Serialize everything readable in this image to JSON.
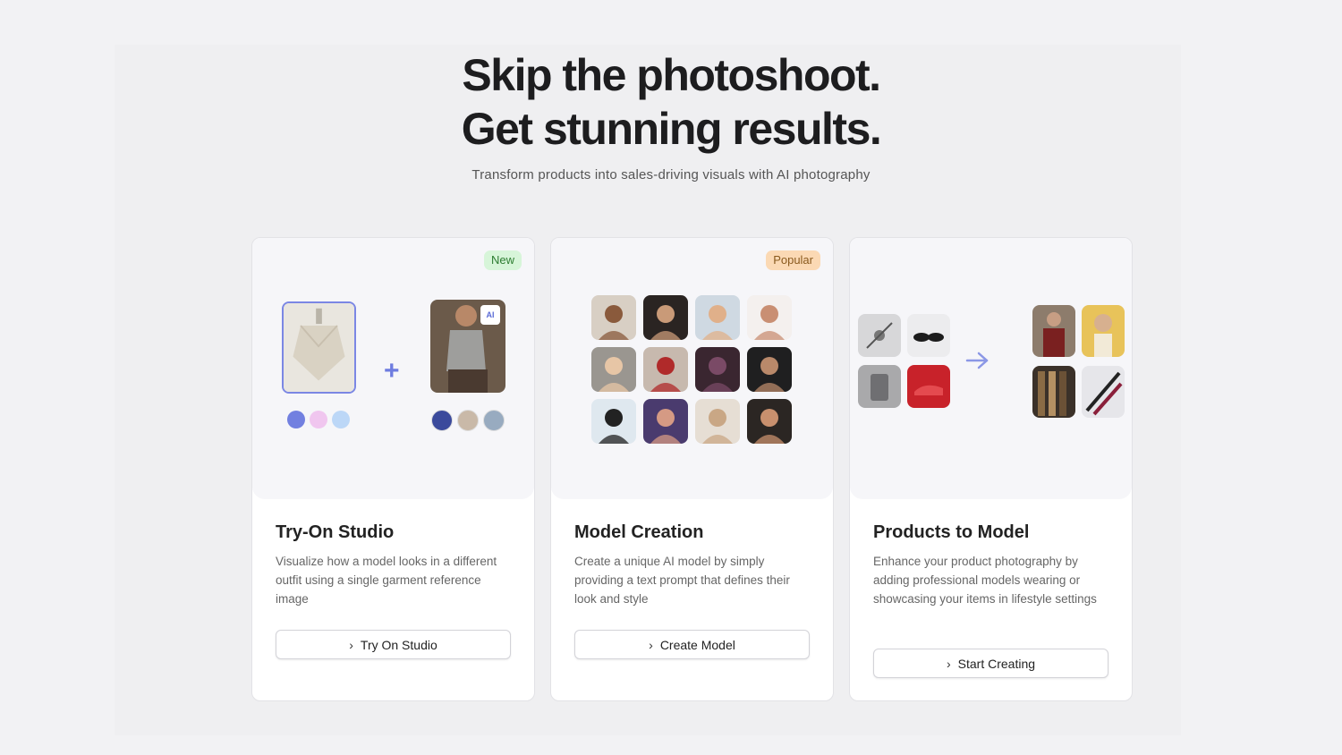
{
  "hero": {
    "title_line1": "Skip the photoshoot.",
    "title_line2": "Get stunning results.",
    "subtitle": "Transform products into sales-driving visuals with AI photography"
  },
  "cards": [
    {
      "badge": "New",
      "title": "Try-On Studio",
      "description": "Visualize how a model looks in a different outfit using a single garment reference image",
      "button_label": "Try On Studio",
      "ai_tag": "AI",
      "color_dots": [
        "#7280e0",
        "#f0c6ef",
        "#bcd7f7"
      ]
    },
    {
      "badge": "Popular",
      "title": "Model Creation",
      "description": "Create a unique AI model by simply providing a text prompt that defines their look and style",
      "button_label": "Create Model"
    },
    {
      "badge": "",
      "title": "Products to Model",
      "description": "Enhance your product photography by adding professional models wearing or showcasing your items in lifestyle settings",
      "button_label": "Start Creating"
    }
  ],
  "icons": {
    "plus": "+",
    "chevron": "›",
    "arrow": "arrow-right-icon"
  },
  "colors": {
    "accent": "#6e7ce0",
    "badge_new_bg": "#d7f5d9",
    "badge_popular_bg": "#fbd9b4"
  }
}
